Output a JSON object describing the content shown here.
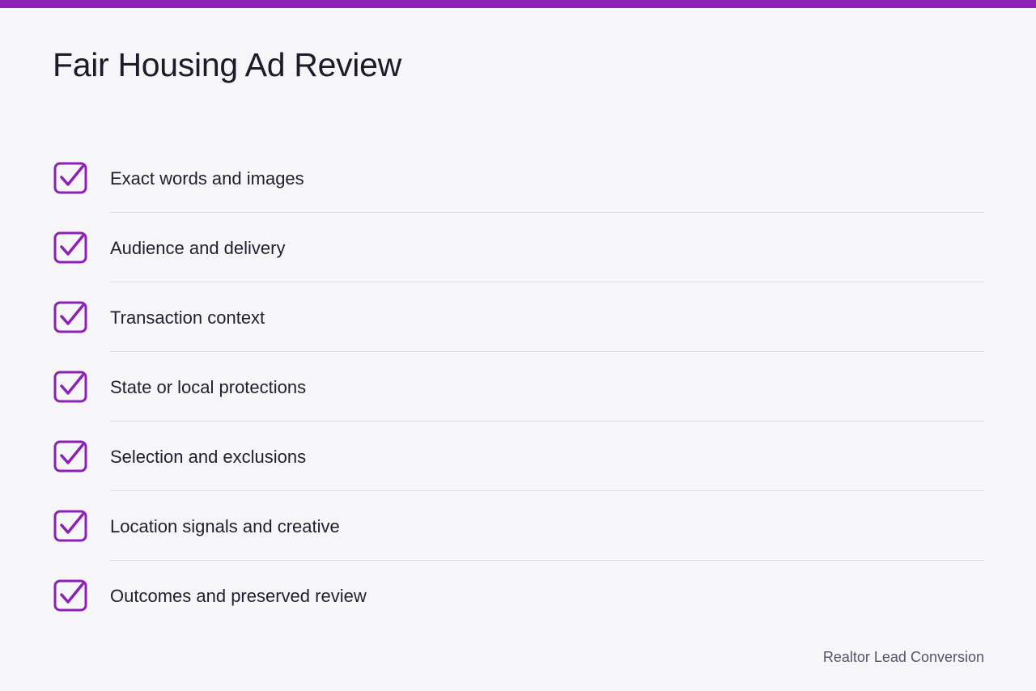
{
  "colors": {
    "accent": "#8b22b5",
    "background": "#f6f6f9",
    "text": "#1b1b29",
    "divider": "#dcdce3",
    "muted_text": "#55556a"
  },
  "header": {
    "title": "Fair Housing Ad Review"
  },
  "checklist": {
    "items": [
      {
        "label": "Exact words and images",
        "checked": true,
        "icon": "checkbox-checked-icon"
      },
      {
        "label": "Audience and delivery",
        "checked": true,
        "icon": "checkbox-checked-icon"
      },
      {
        "label": "Transaction context",
        "checked": true,
        "icon": "checkbox-checked-icon"
      },
      {
        "label": "State or local protections",
        "checked": true,
        "icon": "checkbox-checked-icon"
      },
      {
        "label": "Selection and exclusions",
        "checked": true,
        "icon": "checkbox-checked-icon"
      },
      {
        "label": "Location signals and creative",
        "checked": true,
        "icon": "checkbox-checked-icon"
      },
      {
        "label": "Outcomes and preserved review",
        "checked": true,
        "icon": "checkbox-checked-icon"
      }
    ]
  },
  "footer": {
    "brand": "Realtor Lead Conversion"
  }
}
